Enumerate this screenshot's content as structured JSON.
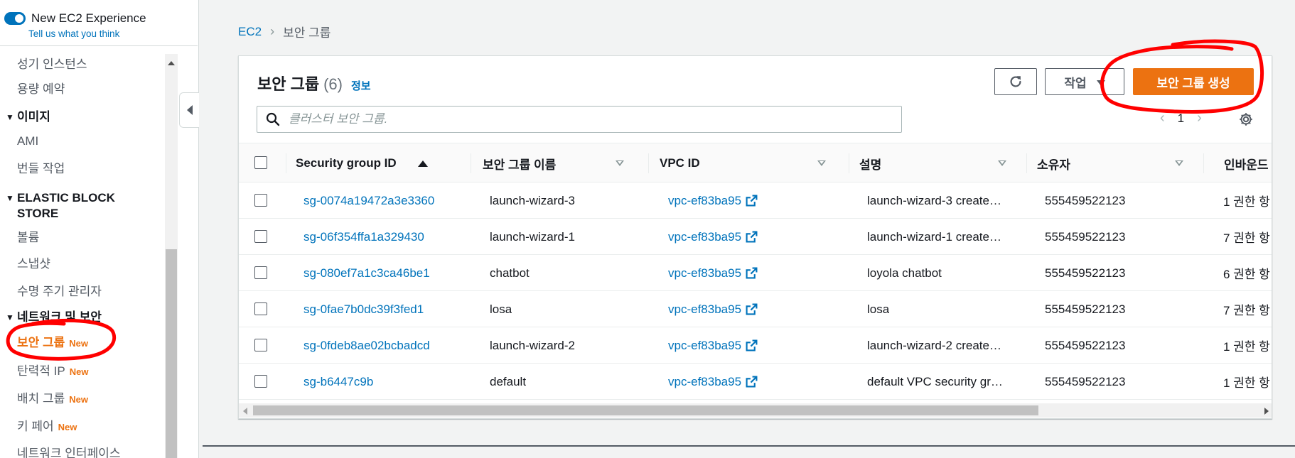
{
  "sidebar": {
    "experience_title": "New EC2 Experience",
    "experience_link": "Tell us what you think",
    "items_top": [
      "성기 인스턴스",
      "용량 예약"
    ],
    "sections": {
      "images": {
        "title": "이미지",
        "items": [
          "AMI",
          "번들 작업"
        ]
      },
      "ebs": {
        "title": "ELASTIC BLOCK STORE",
        "items": [
          "볼륨",
          "스냅샷",
          "수명 주기 관리자"
        ]
      },
      "network": {
        "title": "네트워크 및 보안",
        "items": [
          {
            "label": "보안 그룹",
            "badge": "New"
          },
          {
            "label": "탄력적 IP",
            "badge": "New"
          },
          {
            "label": "배치 그룹",
            "badge": "New"
          },
          {
            "label": "키 페어",
            "badge": "New"
          },
          {
            "label": "네트워크 인터페이스",
            "badge": ""
          }
        ]
      }
    }
  },
  "breadcrumb": {
    "root": "EC2",
    "current": "보안 그룹"
  },
  "panel": {
    "title": "보안 그룹",
    "count": "(6)",
    "info": "정보",
    "actions_label": "작업",
    "create_label": "보안 그룹 생성",
    "search_placeholder": "클러스터 보안 그룹.",
    "page_number": "1"
  },
  "table": {
    "columns": [
      "Security group ID",
      "보안 그룹 이름",
      "VPC ID",
      "설명",
      "소유자",
      "인바운드"
    ],
    "rows": [
      {
        "id": "sg-0074a19472a3e3360",
        "name": "launch-wizard-3",
        "vpc": "vpc-ef83ba95",
        "desc": "launch-wizard-3 create…",
        "owner": "555459522123",
        "inbound": "1 권한 항"
      },
      {
        "id": "sg-06f354ffa1a329430",
        "name": "launch-wizard-1",
        "vpc": "vpc-ef83ba95",
        "desc": "launch-wizard-1 create…",
        "owner": "555459522123",
        "inbound": "7 권한 항"
      },
      {
        "id": "sg-080ef7a1c3ca46be1",
        "name": "chatbot",
        "vpc": "vpc-ef83ba95",
        "desc": "loyola chatbot",
        "owner": "555459522123",
        "inbound": "6 권한 항"
      },
      {
        "id": "sg-0fae7b0dc39f3fed1",
        "name": "losa",
        "vpc": "vpc-ef83ba95",
        "desc": "losa",
        "owner": "555459522123",
        "inbound": "7 권한 항"
      },
      {
        "id": "sg-0fdeb8ae02bcbadcd",
        "name": "launch-wizard-2",
        "vpc": "vpc-ef83ba95",
        "desc": "launch-wizard-2 create…",
        "owner": "555459522123",
        "inbound": "1 권한 항"
      },
      {
        "id": "sg-b6447c9b",
        "name": "default",
        "vpc": "vpc-ef83ba95",
        "desc": "default VPC security gr…",
        "owner": "555459522123",
        "inbound": "1 권한 항"
      }
    ]
  },
  "colors": {
    "accent": "#0073bb",
    "primary_button": "#ec7211",
    "annotation": "#ff0000"
  }
}
